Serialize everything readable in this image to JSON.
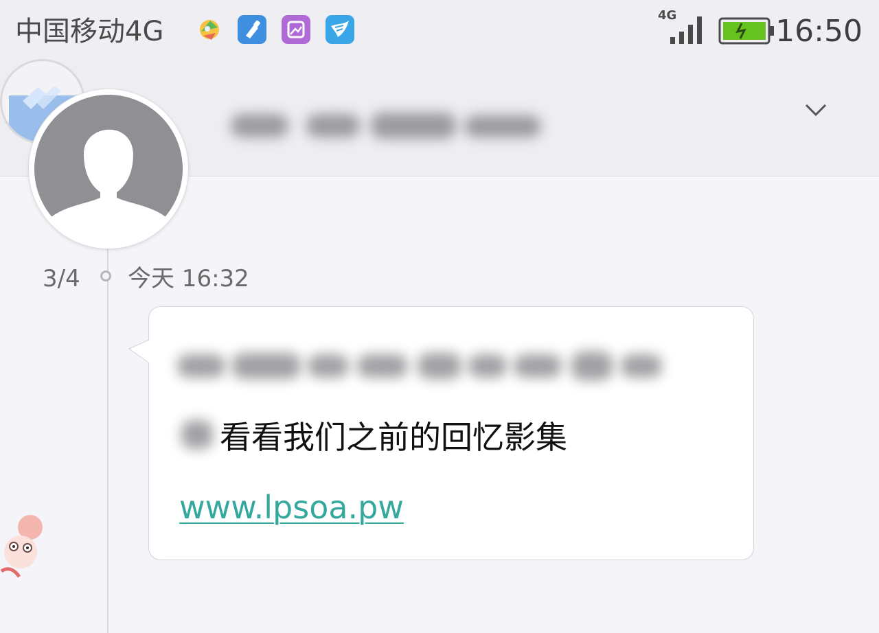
{
  "status_bar": {
    "carrier": "中国移动4G",
    "network_badge": "4G",
    "time": "16:50",
    "app_icons": [
      "multicolor-app-icon",
      "brush-app-icon",
      "gallery-app-icon",
      "bird-app-icon"
    ]
  },
  "header": {
    "expand_icon": "chevron-down-icon"
  },
  "message": {
    "counter": "3/4",
    "timestamp": "今天 16:32",
    "body_text": "看看我们之前的回忆影集",
    "link": "www.lpsoa.pw"
  },
  "colors": {
    "link": "#35a89e",
    "battery": "#66c21e",
    "background": "#f5f4f8"
  }
}
